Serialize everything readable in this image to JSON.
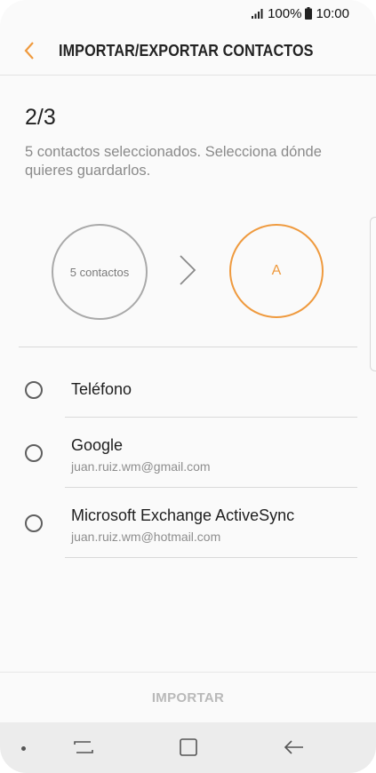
{
  "status_bar": {
    "battery_percent": "100%",
    "time": "10:00",
    "icons": [
      "signal-icon",
      "battery-icon"
    ]
  },
  "header": {
    "back_icon": "chevron-left-icon",
    "title": "IMPORTAR/EXPORTAR CONTACTOS"
  },
  "step": {
    "label": "2/3",
    "description": "5 contactos seleccionados. Selecciona dónde quieres guardarlos."
  },
  "flow": {
    "source_label": "5 contactos",
    "arrow_icon": "chevron-right-icon",
    "target_label": "A"
  },
  "options": [
    {
      "title": "Teléfono",
      "subtitle": "",
      "selected": false
    },
    {
      "title": "Google",
      "subtitle": "juan.ruiz.wm@gmail.com",
      "selected": false
    },
    {
      "title": "Microsoft Exchange ActiveSync",
      "subtitle": "juan.ruiz.wm@hotmail.com",
      "selected": false
    }
  ],
  "actions": {
    "import_label": "IMPORTAR"
  },
  "nav_bar": {
    "icons": [
      "dot-icon",
      "recent-apps-icon",
      "home-icon",
      "back-arrow-icon"
    ]
  },
  "colors": {
    "accent": "#ef9a3e",
    "background": "#fafafa",
    "disabled_text": "#b9b9b9"
  }
}
